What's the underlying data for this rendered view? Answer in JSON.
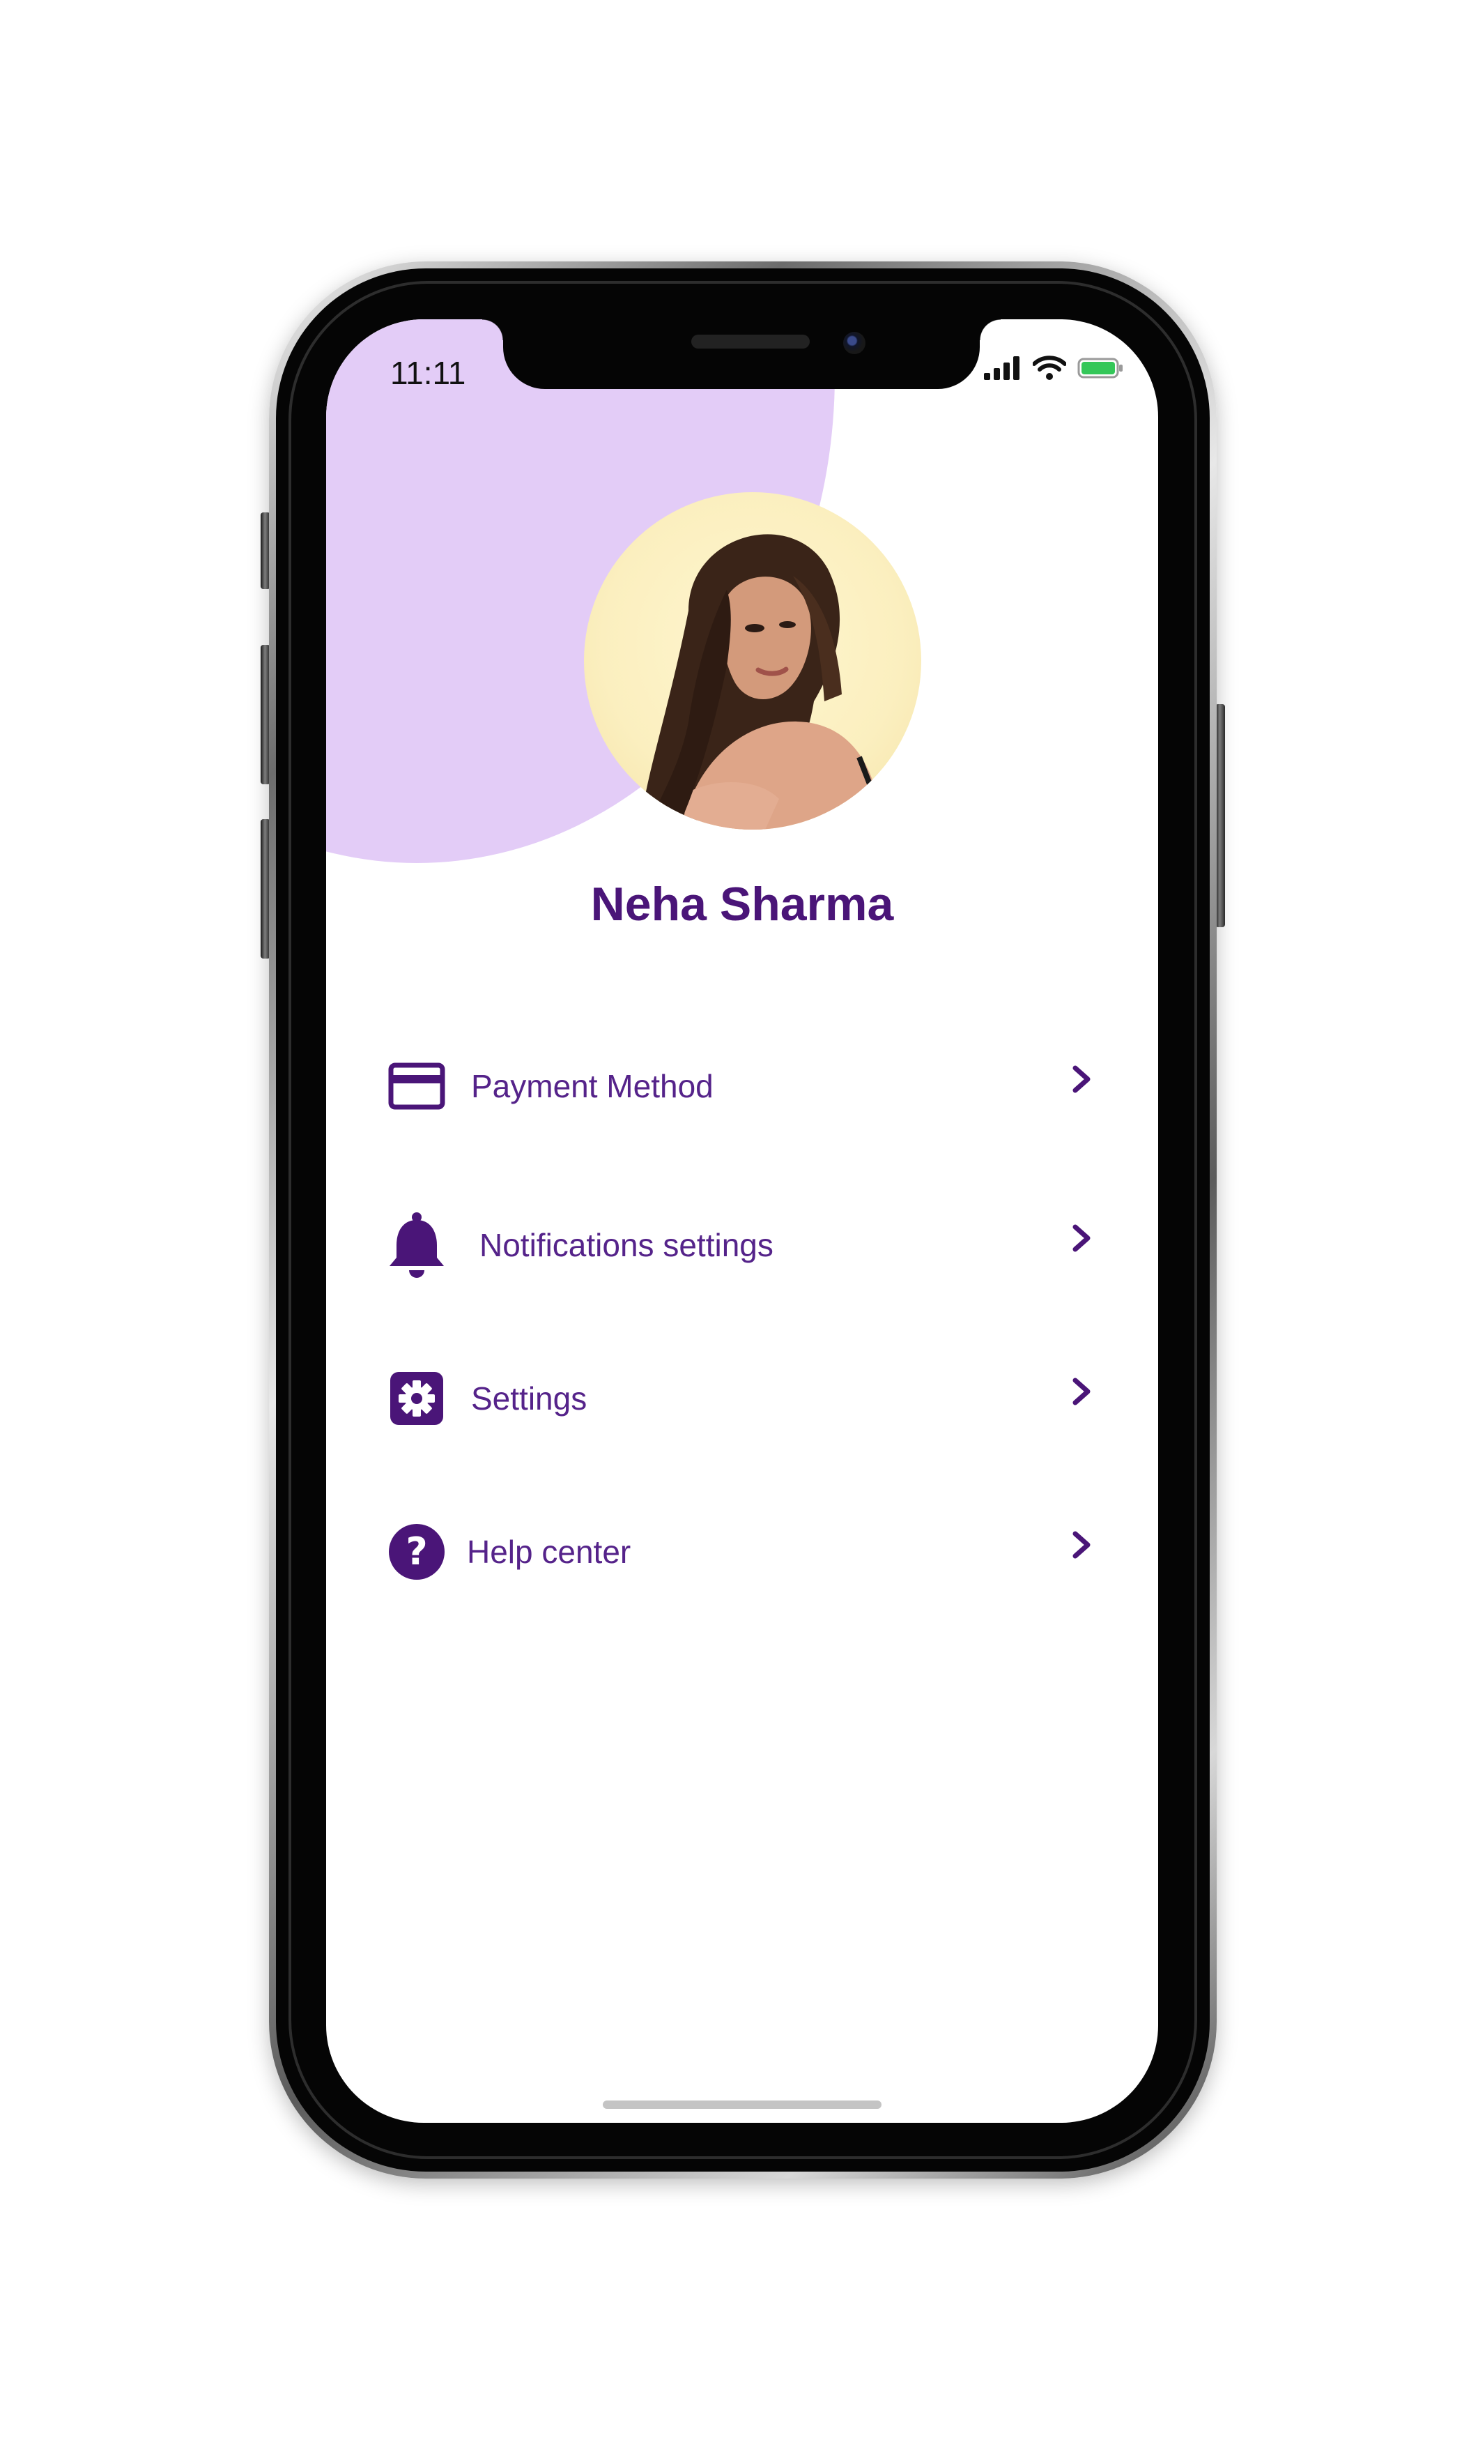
{
  "status_bar": {
    "time": "11:11",
    "icons": [
      "signal-icon",
      "wifi-icon",
      "battery-icon"
    ]
  },
  "profile": {
    "name": "Neha Sharma",
    "avatar_icon": "profile-photo"
  },
  "menu": {
    "items": [
      {
        "label": "Payment Method",
        "icon": "credit-card-icon"
      },
      {
        "label": "Notifications settings",
        "icon": "bell-icon"
      },
      {
        "label": "Settings",
        "icon": "gear-icon"
      },
      {
        "label": "Help center",
        "icon": "help-icon"
      }
    ]
  },
  "colors": {
    "accent": "#4a1578",
    "label": "#55238a",
    "header_blob": "#e3ccf7",
    "avatar_bg": "#fbefbf",
    "battery": "#34c759"
  }
}
